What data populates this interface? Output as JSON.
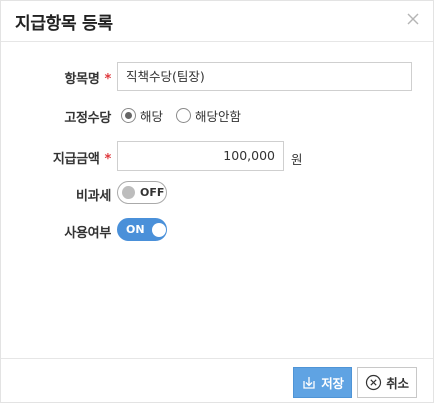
{
  "dialog": {
    "title": "지급항목 등록",
    "close_icon": "close-icon"
  },
  "form": {
    "item_name": {
      "label": "항목명",
      "required_mark": "*",
      "value": "직책수당(팀장)"
    },
    "fixed_allowance": {
      "label": "고정수당",
      "options": [
        {
          "label": "해당",
          "selected": true
        },
        {
          "label": "해당안함",
          "selected": false
        }
      ]
    },
    "amount": {
      "label": "지급금액",
      "required_mark": "*",
      "value": "100,000",
      "unit": "원"
    },
    "tax_exempt": {
      "label": "비과세",
      "state": "OFF"
    },
    "in_use": {
      "label": "사용여부",
      "state": "ON"
    }
  },
  "footer": {
    "save_label": "저장",
    "save_icon": "download-icon",
    "cancel_label": "취소",
    "cancel_icon": "circle-x-icon"
  },
  "colors": {
    "accent": "#4a90d9",
    "save_button": "#5fa3e3",
    "required": "#e0393e"
  }
}
